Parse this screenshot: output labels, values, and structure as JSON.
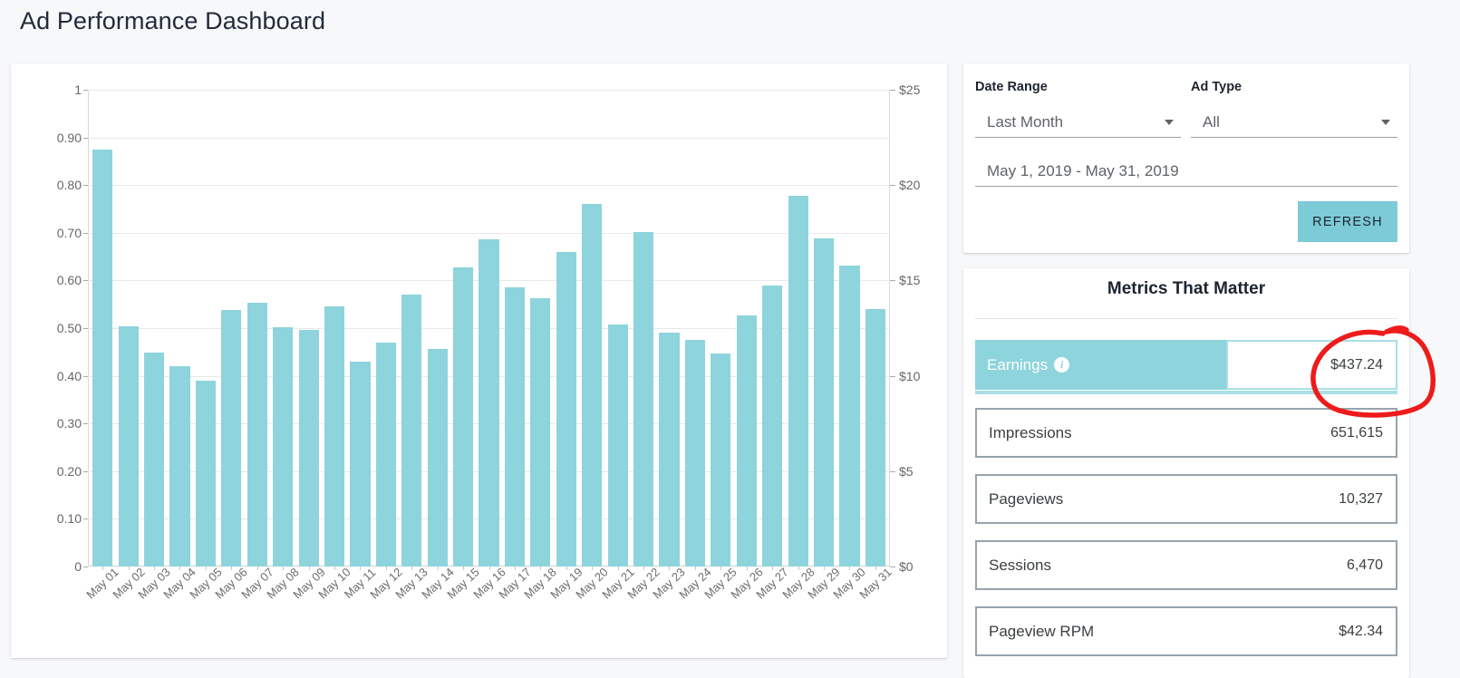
{
  "header": {
    "title": "Ad Performance Dashboard"
  },
  "filters": {
    "date_range_label": "Date Range",
    "date_range_value": "Last Month",
    "ad_type_label": "Ad Type",
    "ad_type_value": "All",
    "date_span_value": "May 1, 2019 - May 31, 2019",
    "refresh_label": "REFRESH",
    "caret_icon": "chevron-down-icon",
    "accent_color": "#7dcbd6"
  },
  "metrics": {
    "title": "Metrics That Matter",
    "rows": [
      {
        "label": "Earnings",
        "value": "$437.24",
        "highlighted": true,
        "info_icon": "info-icon"
      },
      {
        "label": "Impressions",
        "value": "651,615",
        "highlighted": false
      },
      {
        "label": "Pageviews",
        "value": "10,327",
        "highlighted": false
      },
      {
        "label": "Sessions",
        "value": "6,470",
        "highlighted": false
      },
      {
        "label": "Pageview RPM",
        "value": "$42.34",
        "highlighted": false
      }
    ],
    "highlight_color": "#8ed4dc",
    "border_color": "#97a3ad"
  },
  "annotation": {
    "type": "hand-drawn-red-ellipse",
    "target": "$437.24",
    "color": "#ee1b1b"
  },
  "chart_data": {
    "type": "bar",
    "title": "",
    "xlabel": "",
    "ylabel": "",
    "bar_color": "#8ed4dc",
    "grid": true,
    "legend": "none",
    "ylim": [
      0,
      1
    ],
    "y_ticks": [
      "0",
      "0.10",
      "0.20",
      "0.30",
      "0.40",
      "0.50",
      "0.60",
      "0.70",
      "0.80",
      "0.90",
      "1"
    ],
    "y2lim": [
      0,
      25
    ],
    "y2_ticks": [
      "$0",
      "$5",
      "$10",
      "$15",
      "$20",
      "$25"
    ],
    "categories": [
      "May 01",
      "May 02",
      "May 03",
      "May 04",
      "May 05",
      "May 06",
      "May 07",
      "May 08",
      "May 09",
      "May 10",
      "May 11",
      "May 12",
      "May 13",
      "May 14",
      "May 15",
      "May 16",
      "May 17",
      "May 18",
      "May 19",
      "May 20",
      "May 21",
      "May 22",
      "May 23",
      "May 24",
      "May 25",
      "May 26",
      "May 27",
      "May 28",
      "May 29",
      "May 30",
      "May 31"
    ],
    "values": [
      0.875,
      0.503,
      0.448,
      0.421,
      0.389,
      0.539,
      0.553,
      0.502,
      0.496,
      0.545,
      0.43,
      0.469,
      0.57,
      0.457,
      0.627,
      0.686,
      0.585,
      0.562,
      0.659,
      0.761,
      0.508,
      0.702,
      0.491,
      0.475,
      0.446,
      0.527,
      0.59,
      0.778,
      0.688,
      0.631,
      0.54
    ]
  }
}
